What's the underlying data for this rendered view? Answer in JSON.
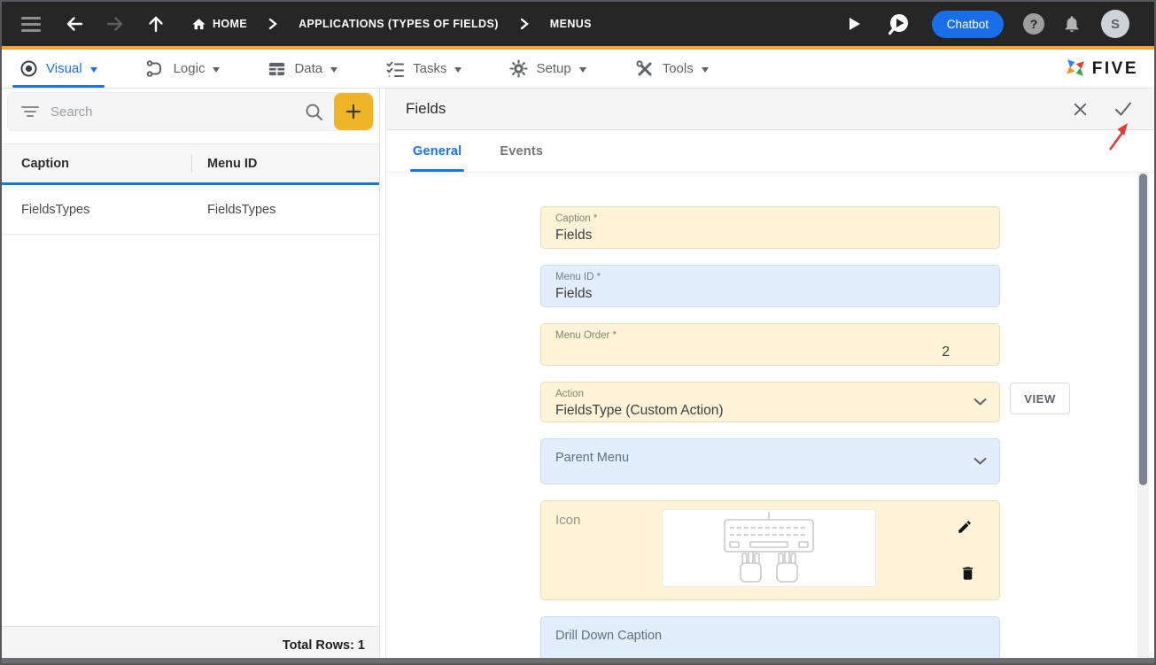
{
  "topbar": {
    "breadcrumb": [
      {
        "label": "HOME"
      },
      {
        "label": "APPLICATIONS (TYPES OF FIELDS)"
      },
      {
        "label": "MENUS"
      }
    ],
    "chatbot_label": "Chatbot",
    "help_glyph": "?",
    "avatar_initial": "S"
  },
  "toolbar": {
    "menus": [
      {
        "label": "Visual",
        "active": true
      },
      {
        "label": "Logic",
        "active": false
      },
      {
        "label": "Data",
        "active": false
      },
      {
        "label": "Tasks",
        "active": false
      },
      {
        "label": "Setup",
        "active": false
      },
      {
        "label": "Tools",
        "active": false
      }
    ],
    "brand": "FIVE"
  },
  "left_panel": {
    "search_placeholder": "Search",
    "columns": [
      {
        "label": "Caption"
      },
      {
        "label": "Menu ID"
      }
    ],
    "rows": [
      {
        "caption": "FieldsTypes",
        "menu_id": "FieldsTypes"
      }
    ],
    "total_rows_label": "Total Rows: 1"
  },
  "right_panel": {
    "title": "Fields",
    "tabs": [
      {
        "label": "General",
        "active": true
      },
      {
        "label": "Events",
        "active": false
      }
    ],
    "form": {
      "fields": [
        {
          "label": "Caption *",
          "value": "Fields"
        },
        {
          "label": "Menu ID *",
          "value": "Fields"
        },
        {
          "label": "Menu Order *",
          "value": "2"
        },
        {
          "label": "Action",
          "value": "FieldsType (Custom Action)"
        },
        {
          "label": "Parent Menu",
          "value": ""
        },
        {
          "label": "Icon",
          "value": ""
        },
        {
          "label": "Drill Down Caption",
          "value": ""
        }
      ],
      "view_button_label": "VIEW"
    }
  },
  "icons": {
    "hamburger-icon": "three bars",
    "arrow-left-icon": "back",
    "arrow-right-icon": "forward (disabled)",
    "arrow-up-icon": "up",
    "home-icon": "house",
    "chevron-right-icon": "breadcrumb separator",
    "play-icon": "run triangle",
    "run-preview-icon": "magnifier with play",
    "help-icon": "? in circle",
    "bell-icon": "notifications",
    "visual-icon": "circled dot",
    "logic-icon": "branch flow",
    "data-icon": "table grid",
    "tasks-icon": "checklist",
    "setup-icon": "gear",
    "tools-icon": "crossed tools",
    "five-logo-icon": "color pinwheel",
    "filter-icon": "filter lines",
    "magnifier-icon": "search glass",
    "plus-icon": "+",
    "close-icon": "x",
    "check-icon": "save tick",
    "chevron-down-icon": "dropdown arrow",
    "pencil-icon": "edit",
    "trash-icon": "delete",
    "keyboard-icon": "keyboard with typing hands",
    "annotation-arrow": "red arrow pointing at save tick"
  },
  "colors": {
    "topbar_bg": "#262626",
    "accent_amber": "#F2A53C",
    "add_button_amber": "#F0B429",
    "active_blue": "#1A73E8",
    "grid_accent_blue": "#1976D2",
    "chatbot_blue": "#1A6FE8",
    "field_changed_bg": "#FDF3D8",
    "field_normal_bg": "#E2EEFB",
    "annotation_red": "#E53935"
  }
}
